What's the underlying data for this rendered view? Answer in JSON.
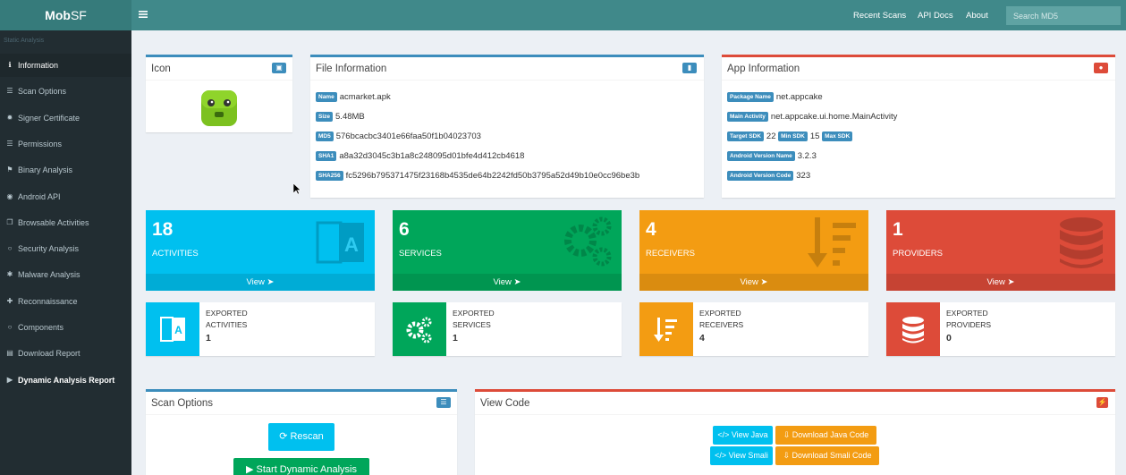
{
  "header": {
    "brand_bold": "Mob",
    "brand_rest": "SF",
    "nav": [
      "Recent Scans",
      "API Docs",
      "About"
    ],
    "search_placeholder": "Search MD5"
  },
  "sidebar": {
    "section": "Static Analysis",
    "items": [
      {
        "label": "Information",
        "icon": "info-circle-icon"
      },
      {
        "label": "Scan Options",
        "icon": "list-icon"
      },
      {
        "label": "Signer Certificate",
        "icon": "certificate-icon"
      },
      {
        "label": "Permissions",
        "icon": "list-icon"
      },
      {
        "label": "Binary Analysis",
        "icon": "flag-icon"
      },
      {
        "label": "Android API",
        "icon": "dot-circle-icon"
      },
      {
        "label": "Browsable Activities",
        "icon": "clone-icon"
      },
      {
        "label": "Security Analysis",
        "icon": "circle-icon"
      },
      {
        "label": "Malware Analysis",
        "icon": "bug-icon"
      },
      {
        "label": "Reconnaissance",
        "icon": "plus-icon"
      },
      {
        "label": "Components",
        "icon": "circle-icon"
      },
      {
        "label": "Download Report",
        "icon": "file-icon"
      },
      {
        "label": "Dynamic Analysis Report",
        "icon": "play-circle-icon"
      }
    ]
  },
  "icon_box": {
    "title": "Icon"
  },
  "file_info": {
    "title": "File Information",
    "rows": [
      {
        "label": "Name",
        "value": "acmarket.apk"
      },
      {
        "label": "Size",
        "value": "5.48MB"
      },
      {
        "label": "MD5",
        "value": "576bcacbc3401e66faa50f1b04023703"
      },
      {
        "label": "SHA1",
        "value": "a8a32d3045c3b1a8c248095d01bfe4d412cb4618"
      },
      {
        "label": "SHA256",
        "value": "fc5296b795371475f23168b4535de64b2242fd50b3795a52d49b10e0cc96be3b"
      }
    ]
  },
  "app_info": {
    "title": "App Information",
    "package_label": "Package Name",
    "package": "net.appcake",
    "main_label": "Main Activity",
    "main": "net.appcake.ui.home.MainActivity",
    "target_label": "Target SDK",
    "target": "22",
    "min_label": "Min SDK",
    "min": "15",
    "max_label": "Max SDK",
    "max": "",
    "vname_label": "Android Version Name",
    "vname": "3.2.3",
    "vcode_label": "Android Version Code",
    "vcode": "323"
  },
  "stats": [
    {
      "num": "18",
      "cap": "ACTIVITIES",
      "view": "View",
      "color": "#00c0ef"
    },
    {
      "num": "6",
      "cap": "SERVICES",
      "view": "View",
      "color": "#00a65a"
    },
    {
      "num": "4",
      "cap": "RECEIVERS",
      "view": "View",
      "color": "#f39c12"
    },
    {
      "num": "1",
      "cap": "PROVIDERS",
      "view": "View",
      "color": "#dd4b39"
    }
  ],
  "exported": [
    {
      "l1": "EXPORTED",
      "l2": "ACTIVITIES",
      "n": "1"
    },
    {
      "l1": "EXPORTED",
      "l2": "SERVICES",
      "n": "1"
    },
    {
      "l1": "EXPORTED",
      "l2": "RECEIVERS",
      "n": "4"
    },
    {
      "l1": "EXPORTED",
      "l2": "PROVIDERS",
      "n": "0"
    }
  ],
  "scan_options": {
    "title": "Scan Options",
    "rescan": "Rescan",
    "dynamic": "Start Dynamic Analysis"
  },
  "view_code": {
    "title": "View Code",
    "view_java": "View Java",
    "download_java": "Download Java Code",
    "view_smali": "View Smali",
    "download_smali": "Download Smali Code"
  }
}
